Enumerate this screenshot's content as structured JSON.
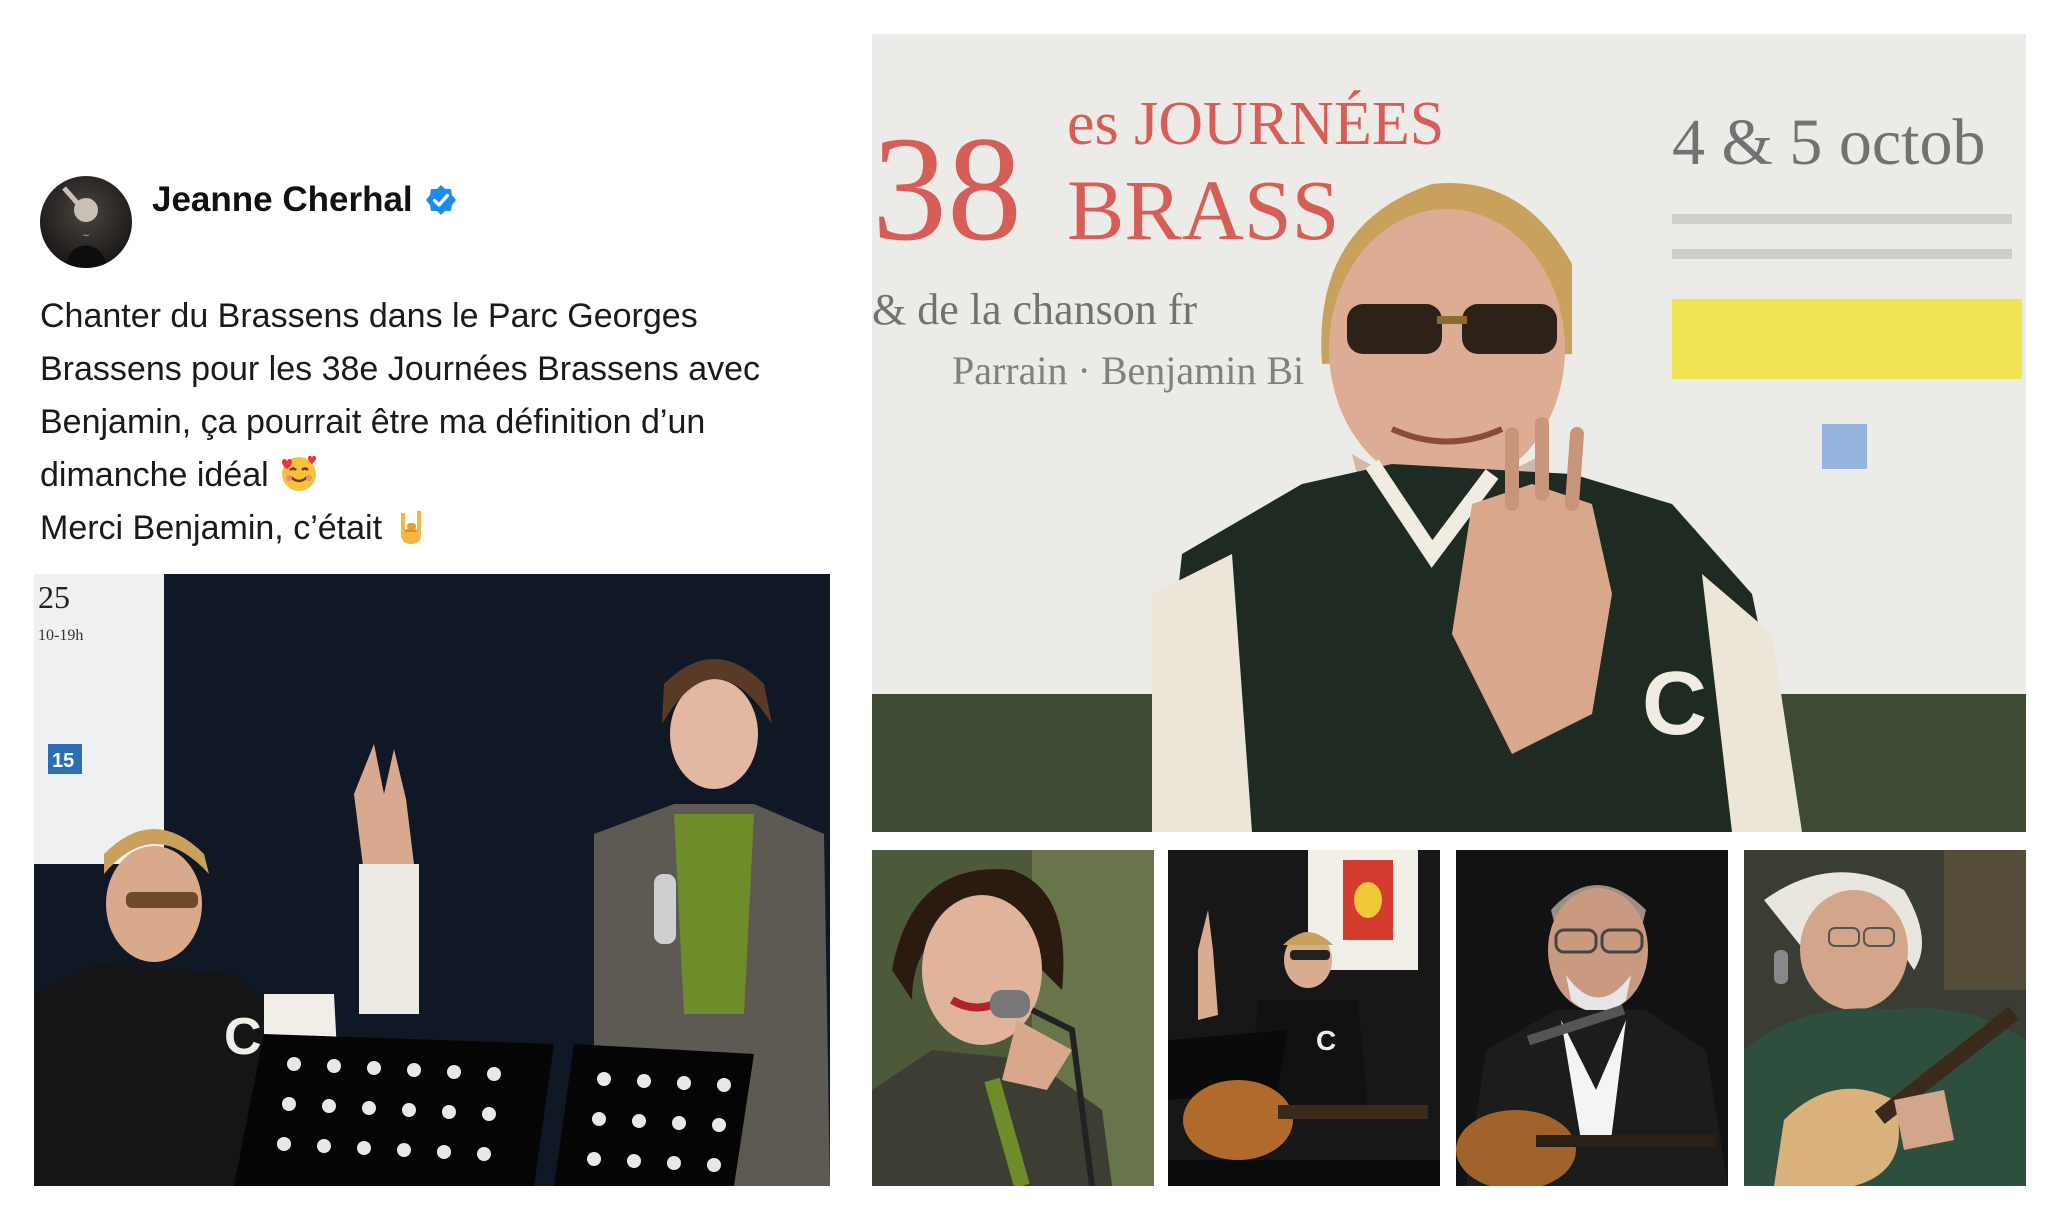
{
  "post": {
    "author_name": "Jeanne Cherhal",
    "verified_icon": "verified-badge-icon",
    "lines": [
      "Chanter du Brassens dans le Parc Georges",
      "Brassens pour les 38e Journées Brassens avec",
      "Benjamin, ça pourrait être ma définition d’un",
      "dimanche idéal",
      "Merci Benjamin, c’était"
    ],
    "emojis": [
      "smiling-face-with-hearts-icon",
      "sign-of-the-horns-icon"
    ]
  },
  "post_photo": {
    "sign_number": "25",
    "sign_hours": "10-19h",
    "sign_badge": "15"
  },
  "main_photo": {
    "banner_number": "38",
    "banner_line1": "es JOURNÉES",
    "banner_line2": "BRASS",
    "banner_subtitle": "& de la chanson fr",
    "banner_parrain": "Parrain · Benjamin Bi",
    "banner_date": "4 & 5 octob",
    "jacket_letter": "C"
  },
  "thumbs": {
    "thumb2_jacket_letter": "C"
  },
  "colors": {
    "banner_red": "#d23a34",
    "verified_blue": "#1d8cf0",
    "banner_yellow": "#f2e33a"
  }
}
